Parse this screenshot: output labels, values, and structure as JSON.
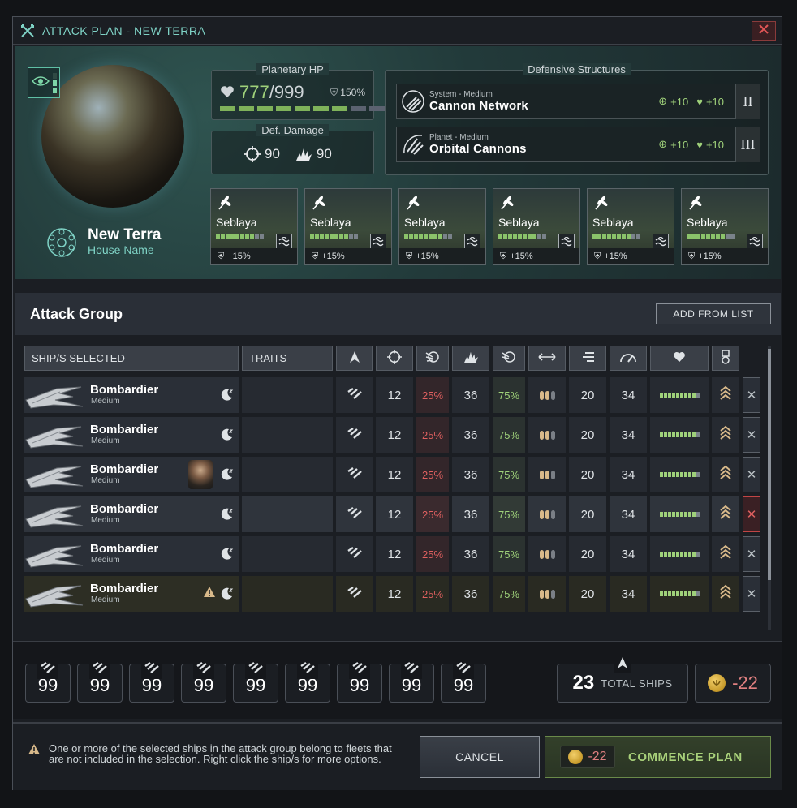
{
  "window": {
    "title": "ATTACK PLAN - NEW TERRA",
    "close_icon": "close-icon"
  },
  "planet": {
    "name": "New Terra",
    "house": "House Name"
  },
  "planetary_hp": {
    "label": "Planetary HP",
    "current": "777",
    "separator": "/",
    "max": "999",
    "modifier": "150%",
    "bar_filled": 7,
    "bar_total": 9
  },
  "def_damage": {
    "label": "Def. Damage",
    "targeting": "90",
    "explosive": "90"
  },
  "defensive_structures": {
    "label": "Defensive Structures",
    "items": [
      {
        "category": "System - Medium",
        "name": "Cannon Network",
        "stat1": "+10",
        "stat2": "+10",
        "tier": "II"
      },
      {
        "category": "Planet - Medium",
        "name": "Orbital Cannons",
        "stat1": "+10",
        "stat2": "+10",
        "tier": "III"
      }
    ]
  },
  "districts": [
    {
      "name": "Seblaya",
      "modifier": "+15%",
      "fill": 8
    },
    {
      "name": "Seblaya",
      "modifier": "+15%",
      "fill": 8
    },
    {
      "name": "Seblaya",
      "modifier": "+15%",
      "fill": 8
    },
    {
      "name": "Seblaya",
      "modifier": "+15%",
      "fill": 8
    },
    {
      "name": "Seblaya",
      "modifier": "+15%",
      "fill": 8
    },
    {
      "name": "Seblaya",
      "modifier": "+15%",
      "fill": 8
    }
  ],
  "attack_group": {
    "title": "Attack Group",
    "add_button": "ADD FROM LIST",
    "headers": {
      "ship": "SHIP/S SELECTED",
      "traits": "TRAITS"
    },
    "rows": [
      {
        "name": "Bombardier",
        "class": "Medium",
        "v1": "12",
        "v2": "25%",
        "v3": "36",
        "v4": "75%",
        "v5": "20",
        "v6": "34",
        "hp_fill": 9,
        "pips": 2,
        "avatar": false,
        "warning": false
      },
      {
        "name": "Bombardier",
        "class": "Medium",
        "v1": "12",
        "v2": "25%",
        "v3": "36",
        "v4": "75%",
        "v5": "20",
        "v6": "34",
        "hp_fill": 9,
        "pips": 2,
        "avatar": false,
        "warning": false
      },
      {
        "name": "Bombardier",
        "class": "Medium",
        "v1": "12",
        "v2": "25%",
        "v3": "36",
        "v4": "75%",
        "v5": "20",
        "v6": "34",
        "hp_fill": 9,
        "pips": 2,
        "avatar": true,
        "warning": false
      },
      {
        "name": "Bombardier",
        "class": "Medium",
        "v1": "12",
        "v2": "25%",
        "v3": "36",
        "v4": "75%",
        "v5": "20",
        "v6": "34",
        "hp_fill": 9,
        "pips": 2,
        "avatar": false,
        "warning": false
      },
      {
        "name": "Bombardier",
        "class": "Medium",
        "v1": "12",
        "v2": "25%",
        "v3": "36",
        "v4": "75%",
        "v5": "20",
        "v6": "34",
        "hp_fill": 9,
        "pips": 2,
        "avatar": false,
        "warning": false
      },
      {
        "name": "Bombardier",
        "class": "Medium",
        "v1": "12",
        "v2": "25%",
        "v3": "36",
        "v4": "75%",
        "v5": "20",
        "v6": "34",
        "hp_fill": 9,
        "pips": 2,
        "avatar": false,
        "warning": true
      }
    ]
  },
  "summary": {
    "counts": [
      "99",
      "99",
      "99",
      "99",
      "99",
      "99",
      "99",
      "99",
      "99"
    ],
    "total_ships": "23",
    "total_label": "TOTAL SHIPS",
    "cost": "-22"
  },
  "footer": {
    "warning": "One or more of the selected ships in the attack group belong to fleets that are not included in the selection. Right click the ship/s for more options.",
    "cancel": "CANCEL",
    "commence_cost": "-22",
    "commence": "COMMENCE PLAN"
  },
  "colors": {
    "accent": "#7fd3c6",
    "positive": "#9fd17a",
    "negative": "#e06060",
    "gold": "#d8b98a"
  }
}
